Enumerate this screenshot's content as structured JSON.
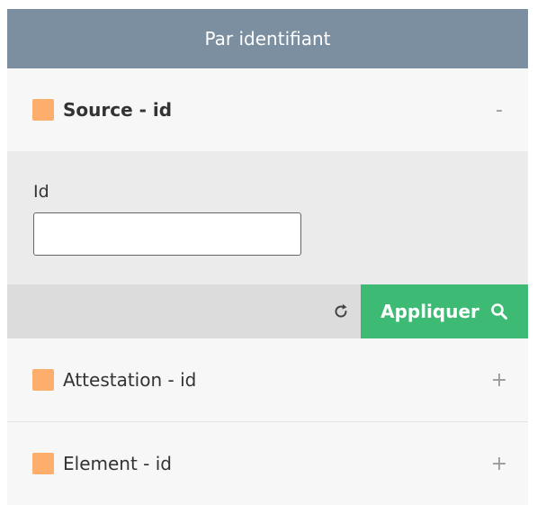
{
  "header": {
    "title": "Par identifiant"
  },
  "sections": [
    {
      "label": "Source - id",
      "toggle": "-"
    },
    {
      "label": "Attestation - id",
      "toggle": "+"
    },
    {
      "label": "Element - id",
      "toggle": "+"
    }
  ],
  "filter": {
    "field_label": "Id",
    "field_value": "",
    "apply_label": "Appliquer"
  },
  "colors": {
    "header_bg": "#7b8fa1",
    "swatch": "#fdae6b",
    "apply_bg": "#3dba73"
  },
  "icons": {
    "reset": "refresh-icon",
    "apply": "search-icon"
  }
}
